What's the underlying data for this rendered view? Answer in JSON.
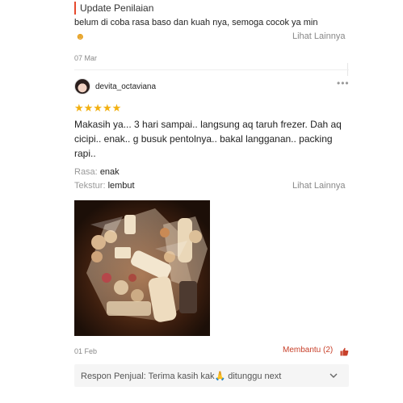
{
  "previous_review": {
    "section_title": "Update Penilaian",
    "text": "belum di coba rasa baso dan kuah nya, semoga cocok ya min",
    "emoji": "☻",
    "see_more": "Lihat Lainnya",
    "date": "07 Mar"
  },
  "review": {
    "username": "devita_octaviana",
    "more_icon": "•••",
    "rating": 5,
    "stars": "★★★★★",
    "text": "Makasih ya... 3 hari sampai.. langsung aq taruh frezer. Dah aq cicipi.. enak.. g busuk pentolnya.. bakal langganan.. packing rapi..",
    "attributes": [
      {
        "label": "Rasa:",
        "value": "enak"
      },
      {
        "label": "Tekstur:",
        "value": "lembut"
      }
    ],
    "see_more": "Lihat Lainnya",
    "date": "01 Feb",
    "helpful_label": "Membantu (2)",
    "seller_response": "Respon Penjual: Terima kasih kak🙏 ditunggu next"
  },
  "colors": {
    "accent": "#e64a2e",
    "star": "#f2b010",
    "helpful": "#c8402a"
  }
}
